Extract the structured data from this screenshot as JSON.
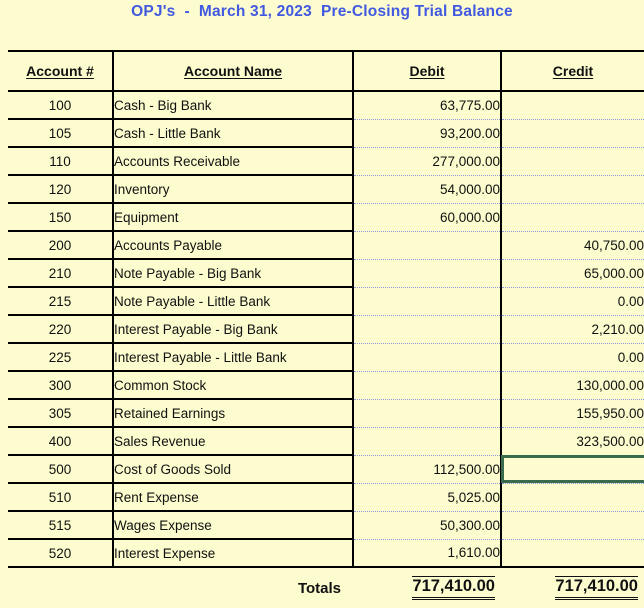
{
  "document": {
    "title": "OPJ's  -  March 31, 2023  Pre-Closing Trial Balance",
    "title_color": "#4159E0",
    "page_background": "#FCFCCF",
    "selection_border_color": "#3A6B4C",
    "grid_line_color": "#000000",
    "amount_row_line_color": "#8E9BD6"
  },
  "table": {
    "headers": {
      "account_number": "Account #",
      "account_name": "Account Name",
      "debit": "Debit",
      "credit": "Credit"
    },
    "rows": [
      {
        "number": "100",
        "name": "Cash - Big Bank",
        "debit": "63,775.00",
        "credit": ""
      },
      {
        "number": "105",
        "name": "Cash - Little Bank",
        "debit": "93,200.00",
        "credit": ""
      },
      {
        "number": "110",
        "name": "Accounts Receivable",
        "debit": "277,000.00",
        "credit": ""
      },
      {
        "number": "120",
        "name": "Inventory",
        "debit": "54,000.00",
        "credit": ""
      },
      {
        "number": "150",
        "name": "Equipment",
        "debit": "60,000.00",
        "credit": ""
      },
      {
        "number": "200",
        "name": "Accounts Payable",
        "debit": "",
        "credit": "40,750.00"
      },
      {
        "number": "210",
        "name": "Note Payable - Big Bank",
        "debit": "",
        "credit": "65,000.00"
      },
      {
        "number": "215",
        "name": "Note Payable - Little Bank",
        "debit": "",
        "credit": "0.00"
      },
      {
        "number": "220",
        "name": "Interest Payable - Big Bank",
        "debit": "",
        "credit": "2,210.00"
      },
      {
        "number": "225",
        "name": "Interest Payable - Little Bank",
        "debit": "",
        "credit": "0.00"
      },
      {
        "number": "300",
        "name": "Common Stock",
        "debit": "",
        "credit": "130,000.00"
      },
      {
        "number": "305",
        "name": "Retained Earnings",
        "debit": "",
        "credit": "155,950.00"
      },
      {
        "number": "400",
        "name": "Sales Revenue",
        "debit": "",
        "credit": "323,500.00"
      },
      {
        "number": "500",
        "name": "Cost of Goods Sold",
        "debit": "112,500.00",
        "credit": ""
      },
      {
        "number": "510",
        "name": "Rent Expense",
        "debit": "5,025.00",
        "credit": ""
      },
      {
        "number": "515",
        "name": "Wages Expense",
        "debit": "50,300.00",
        "credit": ""
      },
      {
        "number": "520",
        "name": "Interest Expense",
        "debit": "1,610.00",
        "credit": ""
      }
    ],
    "totals": {
      "label": "Totals",
      "debit": "717,410.00",
      "credit": "717,410.00"
    },
    "selected_cell": {
      "row_number": "500",
      "row_name": "Cost of Goods Sold",
      "column": "credit",
      "value": ""
    }
  }
}
